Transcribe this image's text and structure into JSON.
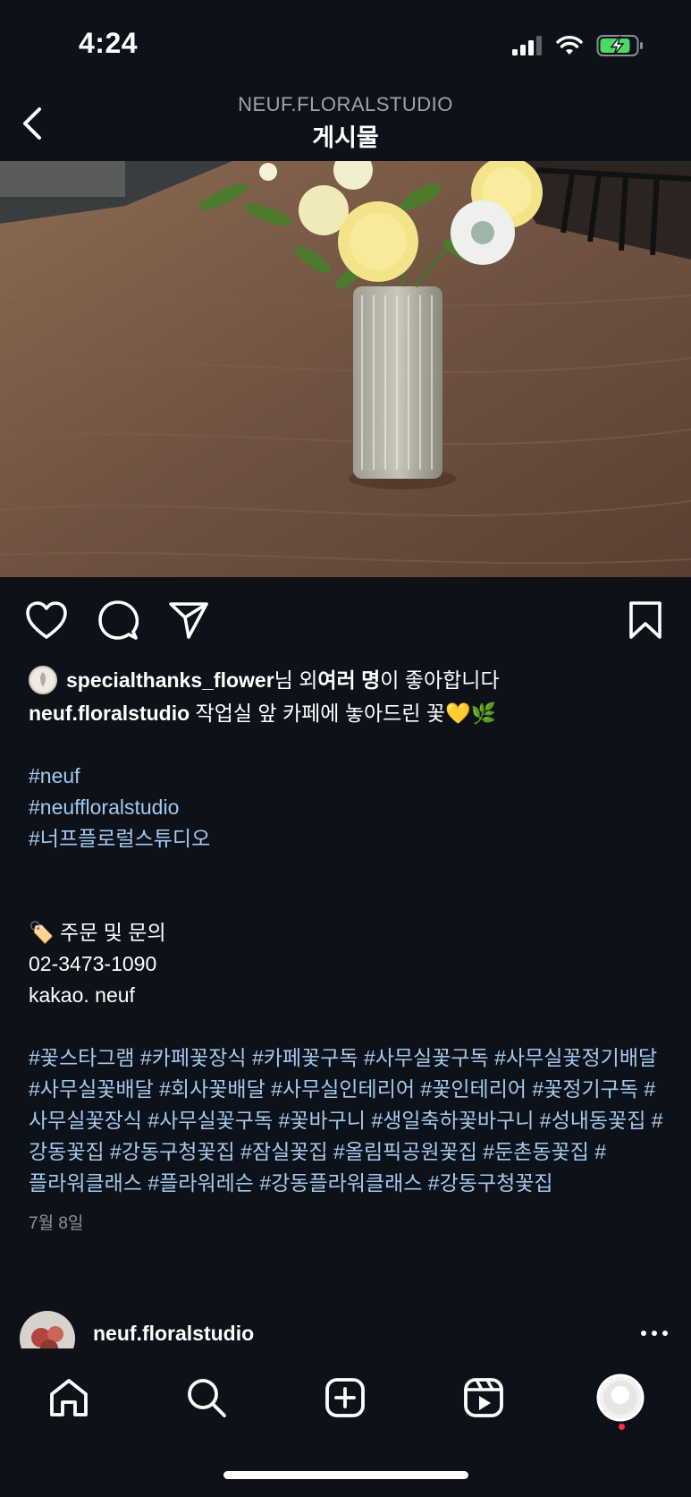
{
  "status_bar": {
    "time": "4:24"
  },
  "header": {
    "username": "NEUF.FLORALSTUDIO",
    "title": "게시물"
  },
  "likes": {
    "liker": "specialthanks_flower",
    "mid": "님 외 ",
    "bold": "여러 명",
    "end": "이 좋아합니다"
  },
  "caption": {
    "author": "neuf.floralstudio",
    "text": " 작업실 앞 카페에 놓아드린 꽃💛🌿",
    "hashtags": [
      "#neuf",
      "#neuffloralstudio",
      "#너프플로럴스튜디오"
    ],
    "order_line": "🏷️ 주문 및 문의",
    "phone": "02-3473-1090",
    "kakao": "kakao. neuf",
    "tags_paragraph": "#꽃스타그램 #카페꽃장식 #카페꽃구독 #사무실꽃구독 #사무실꽃정기배달 #사무실꽃배달 #회사꽃배달 #사무실인테리어 #꽃인테리어 #꽃정기구독 #사무실꽃장식 #사무실꽃구독 #꽃바구니 #생일축하꽃바구니 #성내동꽃집 #강동꽃집 #강동구청꽃집 #잠실꽃집 #올림픽공원꽃집 #둔촌동꽃집 #플라워클래스 #플라워레슨 #강동플라워클래스 #강동구청꽃집",
    "date": "7월 8일"
  },
  "next_post": {
    "username": "neuf.floralstudio"
  },
  "icons": {
    "back": "chevron-left-icon",
    "like": "heart-icon",
    "comment": "comment-icon",
    "share": "paper-plane-icon",
    "save": "bookmark-icon",
    "home": "home-icon",
    "search": "search-icon",
    "create": "plus-square-icon",
    "reels": "reels-icon",
    "profile": "profile-avatar"
  },
  "colors": {
    "background": "#0c111a",
    "hashtag": "#a4c9ee",
    "battery": "#4cd964",
    "notification": "#ff3040"
  }
}
